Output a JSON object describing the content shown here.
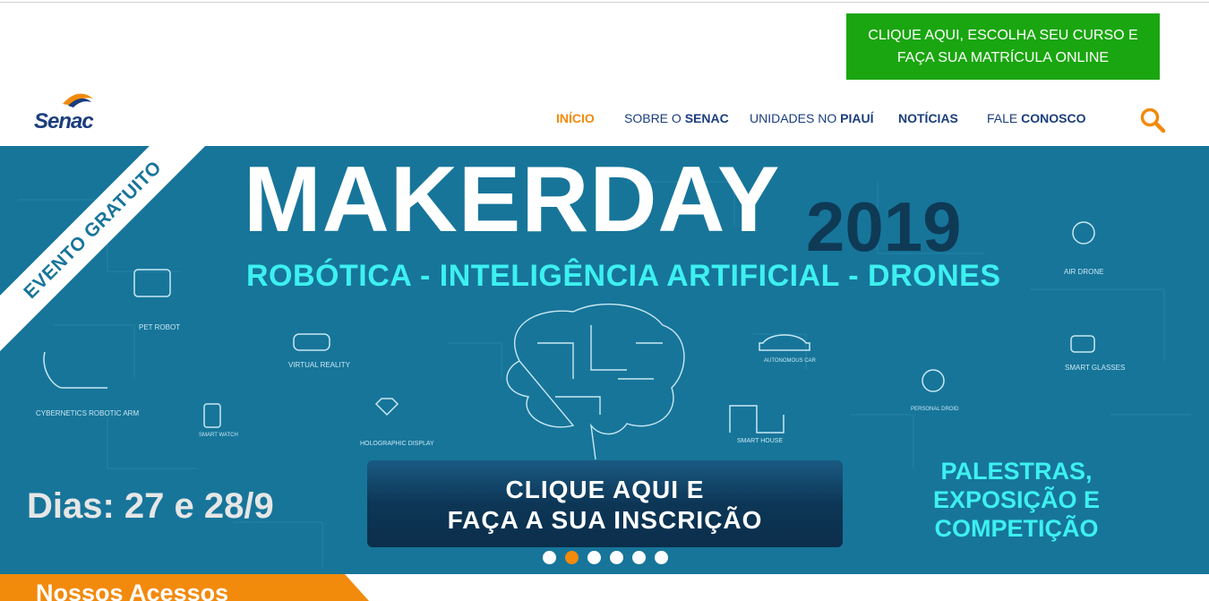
{
  "header": {
    "cta_line1": "CLIQUE AQUI, ESCOLHA SEU CURSO E",
    "cta_line2": "FAÇA SUA MATRÍCULA ONLINE",
    "logo_text": "Senac"
  },
  "nav": {
    "items": [
      {
        "light": "",
        "bold": "INÍCIO"
      },
      {
        "light": "SOBRE O ",
        "bold": "SENAC"
      },
      {
        "light": "UNIDADES NO ",
        "bold": "PIAUÍ"
      },
      {
        "light": "",
        "bold": "NOTÍCIAS"
      },
      {
        "light": "FALE ",
        "bold": "CONOSCO"
      }
    ],
    "active_index": 0
  },
  "banner": {
    "ribbon": "EVENTO GRATUITO",
    "title": "MAKERDAY",
    "year": "2019",
    "subtitle": "ROBÓTICA - INTELIGÊNCIA ARTIFICIAL - DRONES",
    "icon_labels": [
      "PET ROBOT",
      "VIRTUAL REALITY",
      "CYBERNETICS ROBOTIC ARM",
      "SMART WATCH",
      "HOLOGRAPHIC DISPLAY",
      "AUTONOMOUS CAR",
      "SMART HOUSE",
      "PERSONAL DROID",
      "AIR DRONE",
      "SMART GLASSES"
    ],
    "dates": "Dias: 27 e 28/9",
    "cta_line1": "CLIQUE AQUI E",
    "cta_line2": "FAÇA A SUA INSCRIÇÃO",
    "side_line1": "PALESTRAS,",
    "side_line2": "EXPOSIÇÃO E",
    "side_line3": "COMPETIÇÃO"
  },
  "carousel": {
    "slide_count": 6,
    "active_slide": 2
  },
  "section": {
    "title": "Nossos Acessos"
  },
  "colors": {
    "brand_blue": "#1b3d7d",
    "accent_orange": "#f28a0c",
    "cta_green": "#1aa610",
    "banner_bg": "#17759a",
    "cyan_text": "#3df0f0"
  }
}
